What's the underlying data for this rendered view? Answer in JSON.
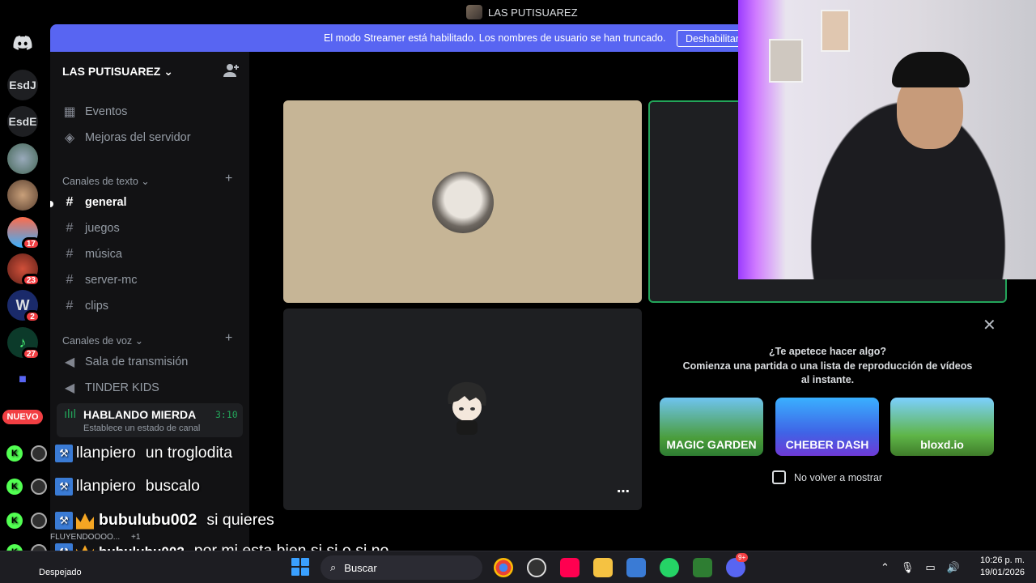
{
  "window": {
    "title": "LAS PUTISUAREZ"
  },
  "rail": {
    "servers": [
      {
        "label": "",
        "icon": "discord-icon"
      },
      {
        "label": "EsdJ"
      },
      {
        "label": "EsdE"
      },
      {
        "label": ""
      },
      {
        "label": ""
      },
      {
        "label": "",
        "badge": "17"
      },
      {
        "label": "",
        "badge": "23"
      },
      {
        "label": "",
        "badge": "2"
      },
      {
        "label": "",
        "badge": "27"
      },
      {
        "label": ""
      }
    ],
    "new_label": "NUEVO"
  },
  "banner": {
    "message": "El modo Streamer está habilitado. Los nombres de usuario se han truncado.",
    "button": "Deshabilitar"
  },
  "sidebar": {
    "server_name": "LAS PUTISUAREZ",
    "top_items": [
      {
        "label": "Eventos",
        "icon": "calendar-icon"
      },
      {
        "label": "Mejoras del servidor",
        "icon": "boost-icon"
      }
    ],
    "text_category": "Canales de texto",
    "text_channels": [
      "general",
      "juegos",
      "música",
      "server-mc",
      "clips"
    ],
    "voice_category": "Canales de voz",
    "voice_channels": [
      "Sala de transmisión",
      "TINDER KIDS"
    ],
    "active_voice": {
      "name": "HABLANDO MIERDA",
      "time": "3:10",
      "status": "Establece un estado de canal"
    },
    "user_panel": {
      "channel": "HABLANDO MIERDA / LAS PUT...",
      "user": "FLUYENDOOOO...",
      "plus": "+1"
    }
  },
  "activity": {
    "question": "¿Te apetece hacer algo?",
    "subtitle": "Comienza una partida o una lista de reproducción de vídeos al instante.",
    "games": [
      "MAGIC GARDEN",
      "CHEBER DASH",
      "bloxd.io"
    ],
    "dont_show": "No volver a mostrar"
  },
  "chat": [
    {
      "name": "llanpiero",
      "message": "un troglodita"
    },
    {
      "name": "llanpiero",
      "message": "buscalo"
    },
    {
      "name": "bubulubu002",
      "message": "si quieres"
    },
    {
      "name": "bubulubu002",
      "message": "por mi esta bien si si o si no"
    }
  ],
  "taskbar": {
    "weather": "Despejado",
    "search_placeholder": "Buscar",
    "time": "10:26 p. m.",
    "date": "19/01/2026",
    "discord_badge": "9+"
  },
  "colors": {
    "blurple": "#5865f2",
    "speaking_green": "#23a55a",
    "badge_red": "#f23f43"
  }
}
